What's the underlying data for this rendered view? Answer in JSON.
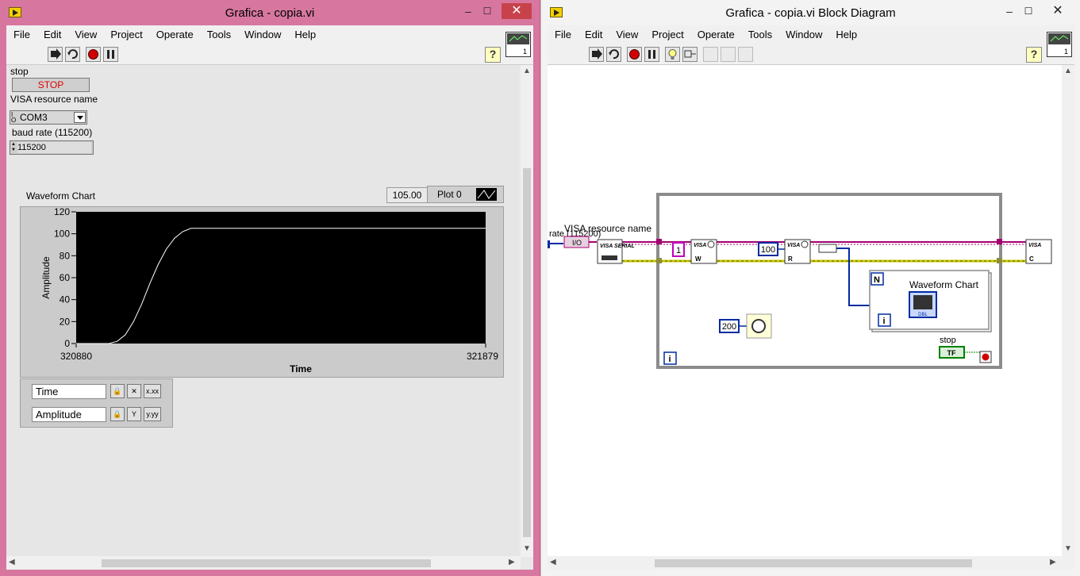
{
  "front_panel": {
    "title": "Grafica - copia.vi",
    "menu": [
      "File",
      "Edit",
      "View",
      "Project",
      "Operate",
      "Tools",
      "Window",
      "Help"
    ],
    "controls": {
      "stop_label": "stop",
      "stop_button": "STOP",
      "visa_label": "VISA resource name",
      "visa_value": "COM3",
      "baud_label": "baud rate (115200)",
      "baud_value": "115200"
    },
    "chart": {
      "label": "Waveform Chart",
      "digital_display": "105.00",
      "plot_legend": "Plot 0",
      "xlabel": "Time",
      "ylabel": "Amplitude",
      "x_min_label": "320880",
      "x_max_label": "321879",
      "y_ticks": [
        "120",
        "100",
        "80",
        "60",
        "40",
        "20",
        "0"
      ]
    },
    "scales": {
      "x_name": "Time",
      "y_name": "Amplitude"
    }
  },
  "chart_data": {
    "type": "line",
    "title": "Waveform Chart",
    "xlabel": "Time",
    "ylabel": "Amplitude",
    "xlim": [
      320880,
      321879
    ],
    "ylim": [
      0,
      120
    ],
    "series": [
      {
        "name": "Plot 0",
        "x": [
          320880,
          320960,
          320980,
          321000,
          321020,
          321040,
          321060,
          321080,
          321100,
          321120,
          321140,
          321160,
          321879
        ],
        "y": [
          0,
          0,
          2,
          8,
          20,
          36,
          55,
          72,
          86,
          96,
          102,
          105,
          105
        ]
      }
    ],
    "grid": false,
    "line_color": "#ffffff",
    "background": "#000000"
  },
  "block_diagram": {
    "title": "Grafica - copia.vi Block Diagram",
    "menu": [
      "File",
      "Edit",
      "View",
      "Project",
      "Operate",
      "Tools",
      "Window",
      "Help"
    ],
    "labels": {
      "visa_resource": "VISA resource name",
      "rate": "rate (115200)",
      "io": "I/O",
      "const_1": "1",
      "const_100": "100",
      "const_200": "200",
      "waveform_chart": "Waveform Chart",
      "stop": "stop",
      "tf": "TF",
      "n": "N",
      "i": "i",
      "loop_i": "i",
      "visa_serial": "VISA SERIAL",
      "visa_write": "VISA",
      "visa_read": "VISA",
      "visa_close": "VISA",
      "dbl": "DBL",
      "help": "?"
    }
  },
  "colors": {
    "frame": "#d7779f",
    "panel": "#e6e6e6",
    "chart_bg": "#000000",
    "stop_text": "#e00000",
    "visa_wire": "#a4006f",
    "error_wire": "#c8c800",
    "numeric_wire": "#002ba0"
  }
}
